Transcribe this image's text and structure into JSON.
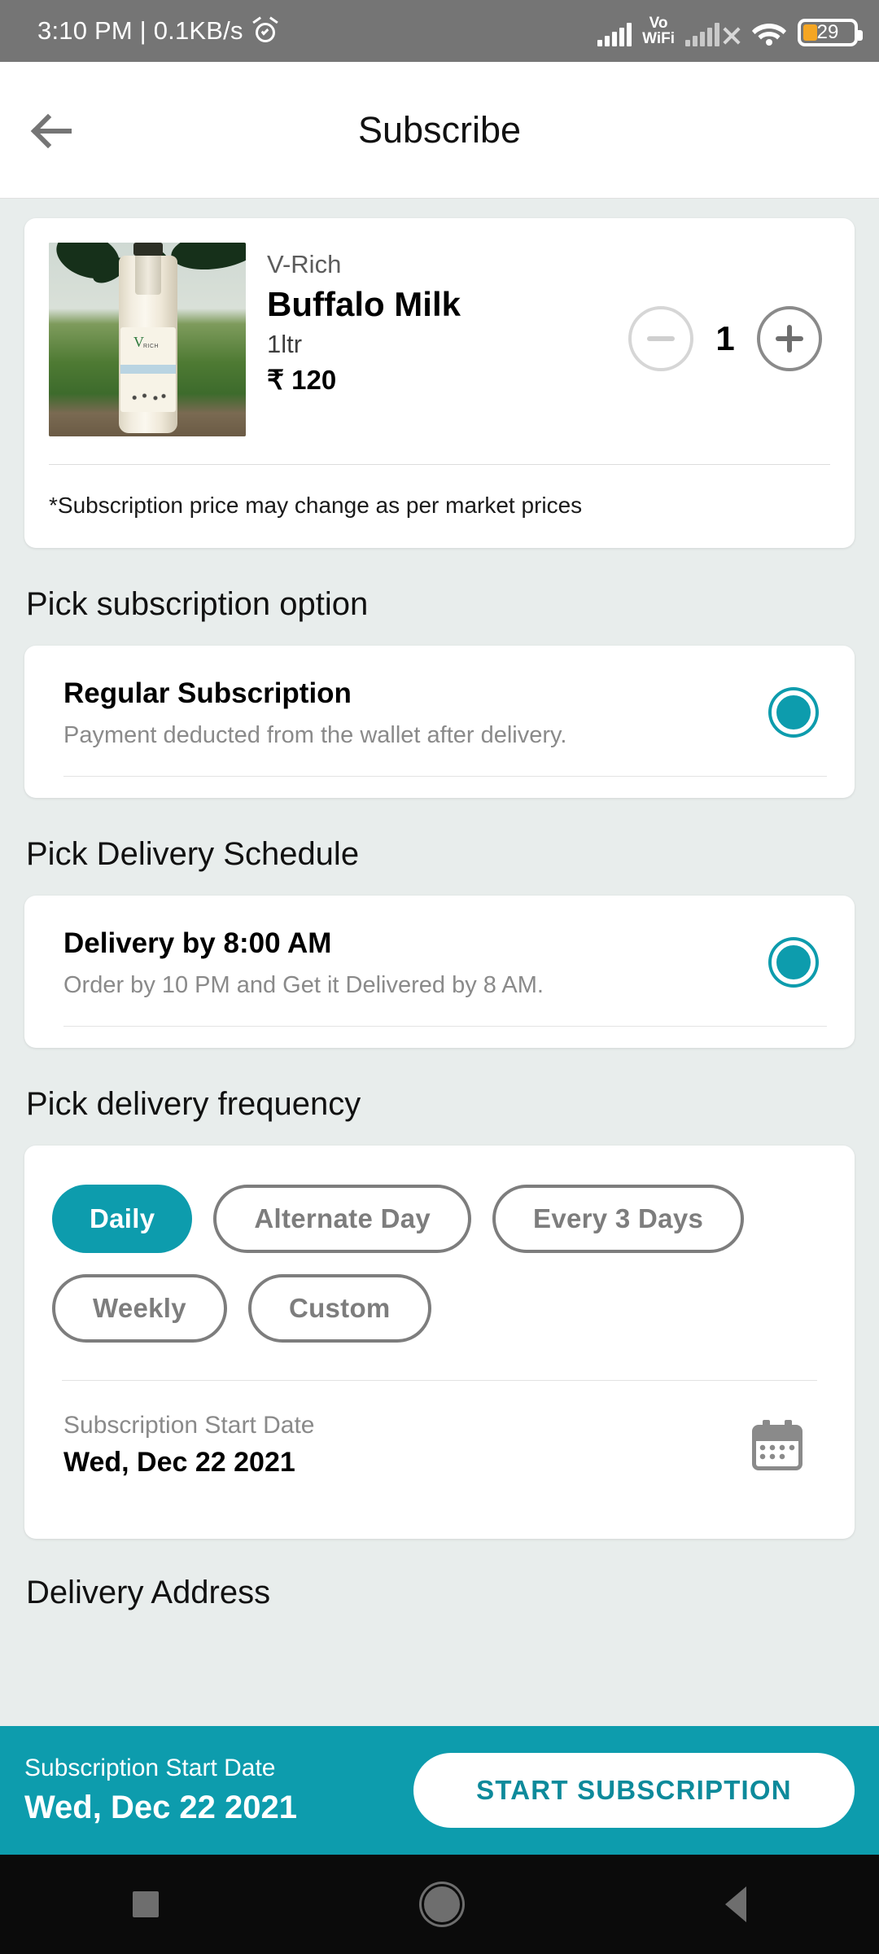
{
  "status_bar": {
    "time_and_speed": "3:10 PM | 0.1KB/s",
    "alarm_icon": "alarm-clock-icon",
    "signal_icon": "signal-bars-icon",
    "volte_wifi_line1": "Vo",
    "volte_wifi_line2": "WiFi",
    "sim2_icon": "signal-bars-no-service-icon",
    "wifi_icon": "wifi-icon",
    "battery_percent": "29"
  },
  "app_bar": {
    "back_icon": "back-arrow-icon",
    "title": "Subscribe"
  },
  "product": {
    "image_alt": "buffalo-milk-bottle-photo",
    "brand": "V-Rich",
    "name": "Buffalo Milk",
    "size": "1ltr",
    "price": "₹ 120",
    "quantity": "1",
    "decrease_label": "minus-icon",
    "increase_label": "plus-icon",
    "note": "*Subscription price may change as per market prices"
  },
  "subscription_option": {
    "section_title": "Pick subscription option",
    "options": [
      {
        "title": "Regular Subscription",
        "subtitle": "Payment deducted from the wallet after delivery.",
        "selected": true
      }
    ]
  },
  "delivery_schedule": {
    "section_title": "Pick Delivery Schedule",
    "options": [
      {
        "title": "Delivery by 8:00 AM",
        "subtitle": "Order by 10 PM and Get it Delivered by 8 AM.",
        "selected": true
      }
    ]
  },
  "delivery_frequency": {
    "section_title": "Pick delivery frequency",
    "chips": [
      {
        "label": "Daily",
        "selected": true
      },
      {
        "label": "Alternate Day",
        "selected": false
      },
      {
        "label": "Every 3 Days",
        "selected": false
      },
      {
        "label": "Weekly",
        "selected": false
      },
      {
        "label": "Custom",
        "selected": false
      }
    ],
    "start_date_label": "Subscription Start Date",
    "start_date_value": "Wed, Dec 22 2021",
    "calendar_icon": "calendar-icon"
  },
  "delivery_address": {
    "section_title": "Delivery Address"
  },
  "bottom_bar": {
    "start_date_label": "Subscription Start Date",
    "start_date_value": "Wed, Dec 22 2021",
    "cta_label": "START SUBSCRIPTION"
  },
  "nav_bar": {
    "recents_icon": "square-recents-icon",
    "home_icon": "circle-home-icon",
    "back_icon": "triangle-back-icon"
  },
  "colors": {
    "accent": "#0D9CAD",
    "page_bg": "#E8EDEC",
    "card_bg": "#FFFFFF",
    "status_bar_bg": "#757575",
    "battery_fill": "#F5A623"
  }
}
